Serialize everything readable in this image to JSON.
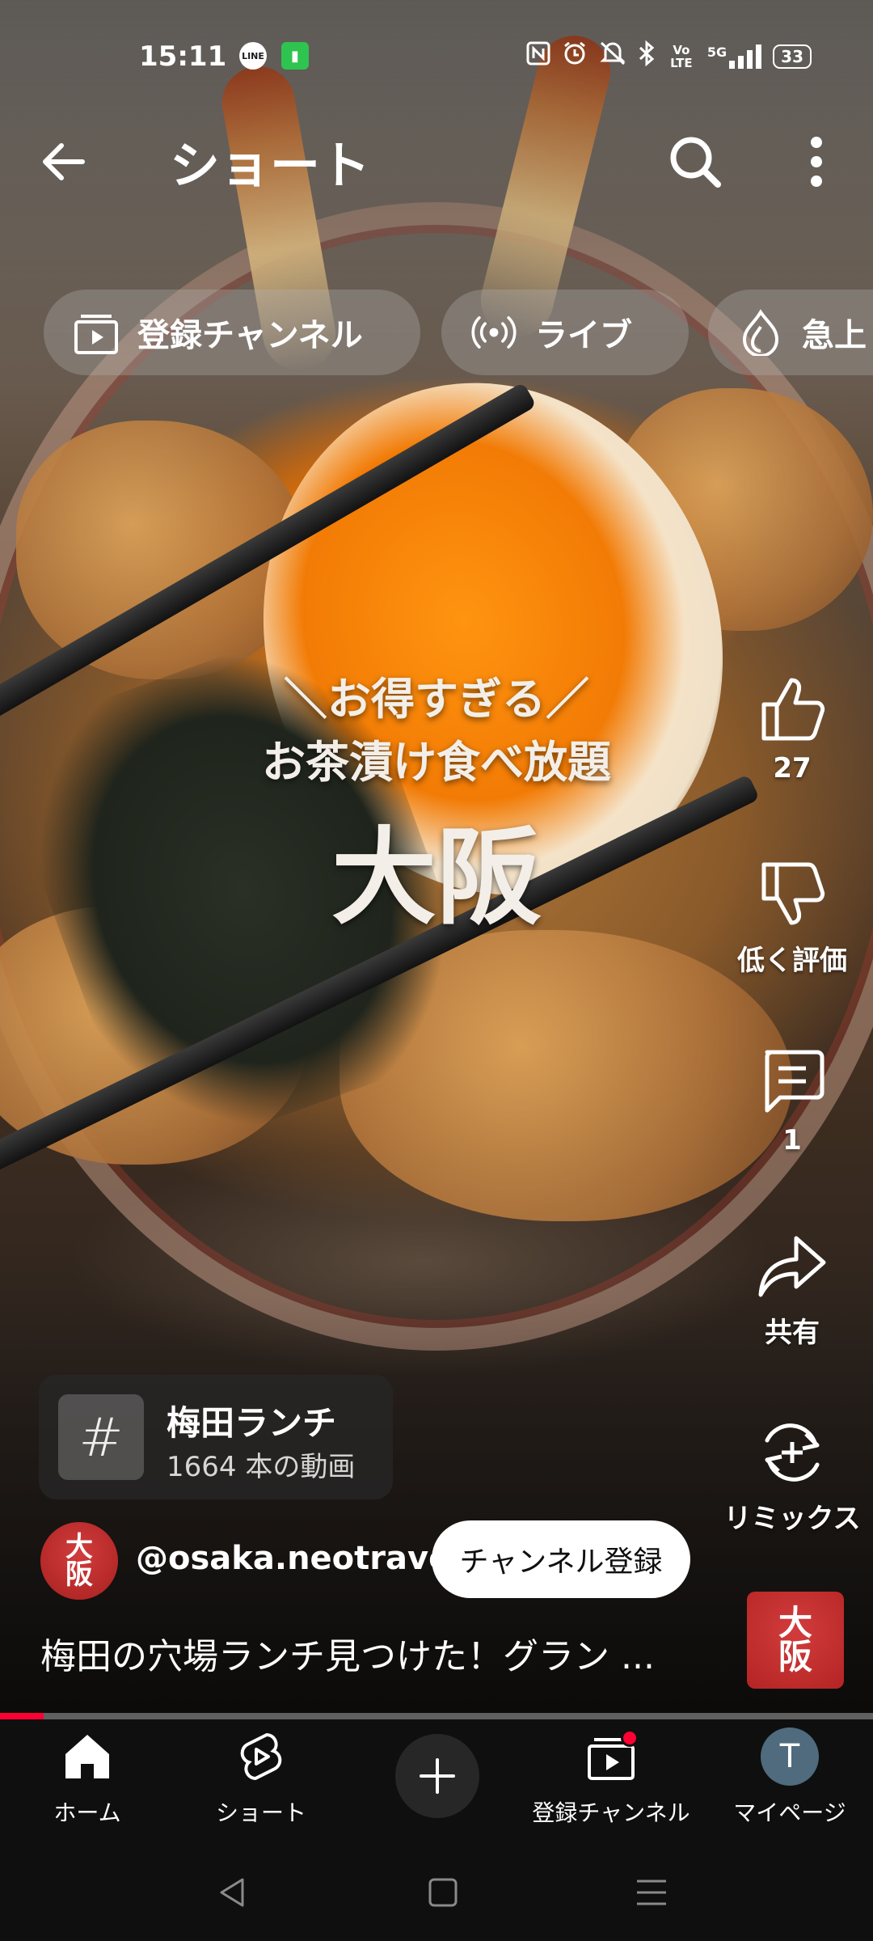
{
  "status_bar": {
    "time": "15:11",
    "line_badge": "LINE",
    "network": "5G",
    "volte": "Vo LTE",
    "battery": "33"
  },
  "header": {
    "title": "ショート"
  },
  "chips": [
    {
      "label": "登録チャンネル",
      "icon": "subscriptions-icon"
    },
    {
      "label": "ライブ",
      "icon": "live-icon"
    },
    {
      "label": "急上",
      "icon": "trending-icon"
    }
  ],
  "video_overlay": {
    "line1": "＼お得すぎる／",
    "line2": "お茶漬け食べ放題",
    "line3": "大阪"
  },
  "actions": {
    "like_count": "27",
    "dislike_label": "低く評価",
    "comment_count": "1",
    "share_label": "共有",
    "remix_label": "リミックス"
  },
  "hashtag": {
    "symbol": "#",
    "name": "梅田ランチ",
    "count": "1664 本の動画"
  },
  "channel": {
    "avatar_text": "大阪",
    "handle": "@osaka.neotravel",
    "subscribe_label": "チャンネル登録"
  },
  "description": "梅田の穴場ランチ見つけた！グラン ...",
  "mini_logo_text": "大阪",
  "progress": {
    "fraction": 0.05
  },
  "bottom_nav": {
    "home": "ホーム",
    "shorts": "ショート",
    "subscriptions": "登録チャンネル",
    "me": "マイページ",
    "me_initial": "T"
  },
  "colors": {
    "accent_red": "#ff0033",
    "nav_bg": "#0f0f0f"
  }
}
